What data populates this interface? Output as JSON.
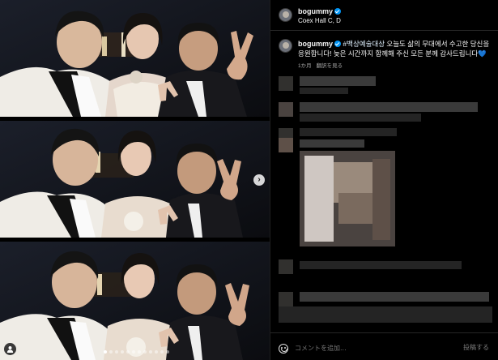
{
  "post": {
    "username": "bogummy",
    "location": "Coex Hall C, D",
    "caption_hashtag": "#백상예술대상",
    "caption_text": " 오늘도 삶의 무대에서 수고한 당신을 응원합니다! 늦은 시간까지 함께해 주신 모든 분께 감사드립니다",
    "caption_emoji": "💙",
    "time_ago": "1か月",
    "translate_label": "翻訳を見る"
  },
  "comment_box": {
    "placeholder": "コメントを追加...",
    "post_label": "投稿する"
  },
  "carousel": {
    "slide_count": 12,
    "active_index": 0
  },
  "colors": {
    "background": "#000000",
    "verified": "#0095f6",
    "muted_text": "#a8a8a8"
  },
  "icons": [
    "verified-badge-icon",
    "chevron-right-icon",
    "user-tag-icon",
    "emoji-icon"
  ]
}
